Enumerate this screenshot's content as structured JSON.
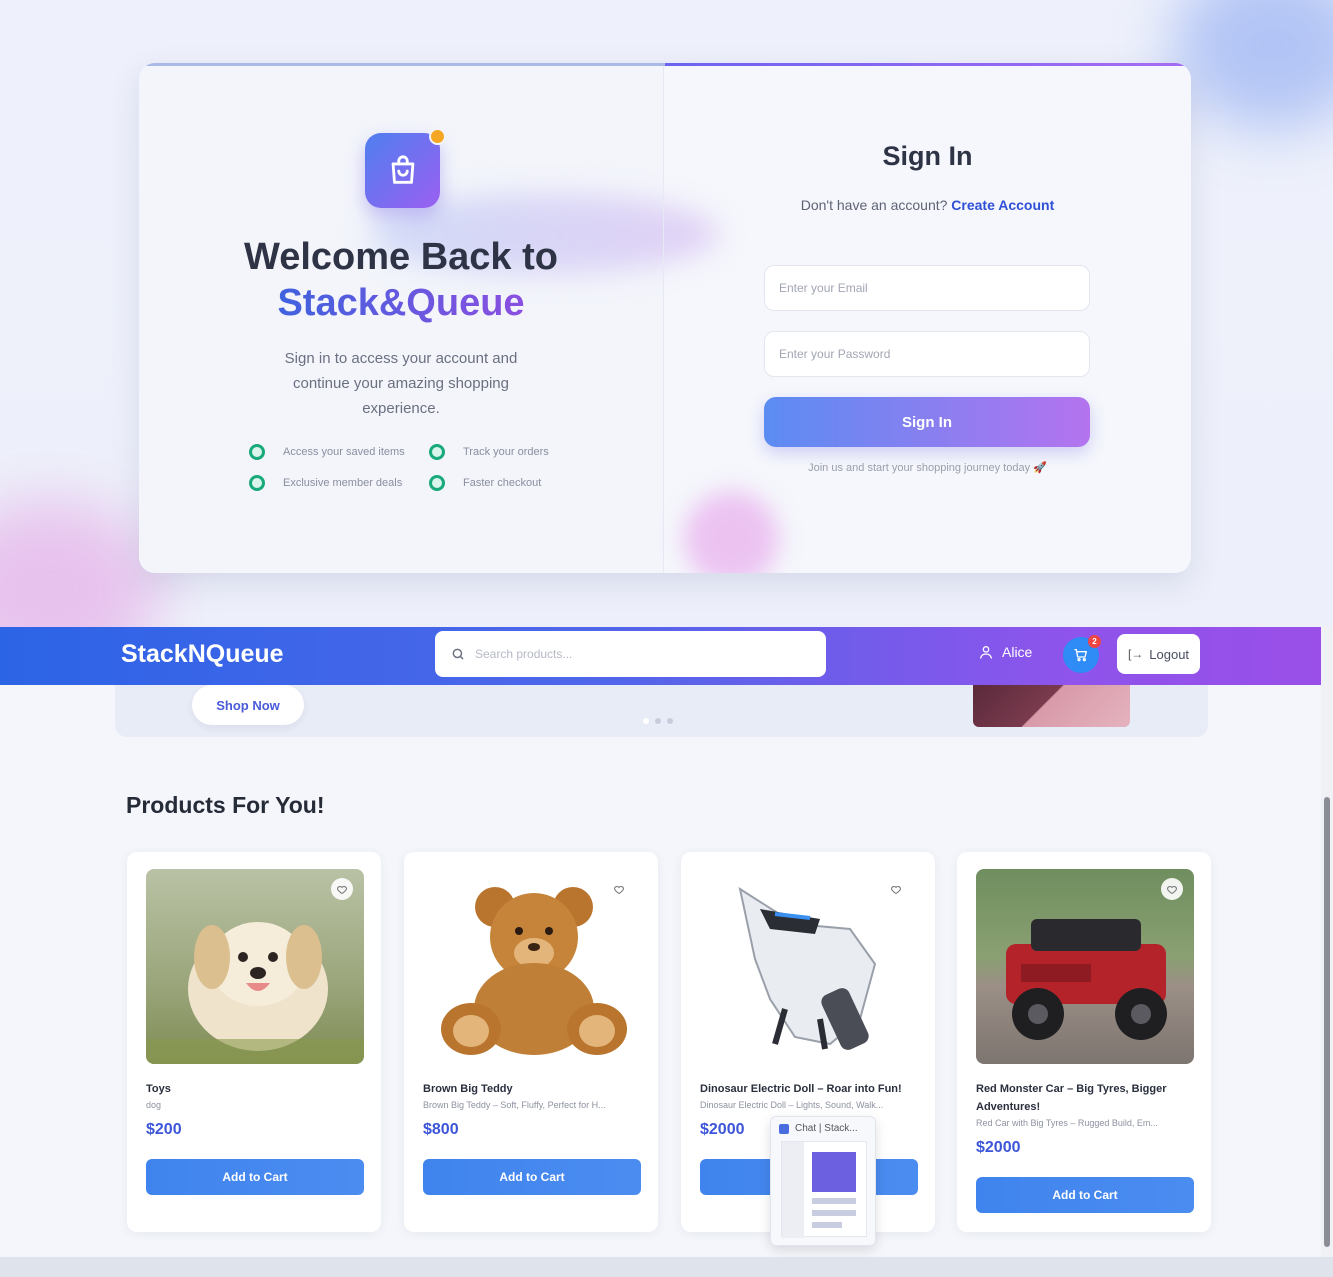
{
  "auth": {
    "welcome_line1": "Welcome Back to",
    "welcome_line2": "Stack&Queue",
    "subtitle": "Sign in to access your account and continue your amazing shopping experience.",
    "features": [
      "Access your saved items",
      "Track your orders",
      "Exclusive member deals",
      "Faster checkout"
    ],
    "title": "Sign In",
    "prompt_text": "Don't have an account?",
    "create_account_link": "Create Account",
    "email_placeholder": "Enter your Email",
    "password_placeholder": "Enter your Password",
    "signin_button": "Sign In",
    "footer_note": "Join us and start your shopping journey today",
    "footer_emoji": "🚀"
  },
  "store": {
    "brand": "StackNQueue",
    "search_placeholder": "Search products...",
    "user_name": "Alice",
    "cart_count": "2",
    "logout_label": "Logout",
    "shop_now_label": "Shop Now",
    "section_title": "Products For You!",
    "products": [
      {
        "name": "Toys",
        "desc": "dog",
        "price": "$200",
        "button": "Add to Cart"
      },
      {
        "name": "Brown Big Teddy",
        "desc": "Brown Big Teddy – Soft, Fluffy, Perfect for H...",
        "price": "$800",
        "button": "Add to Cart"
      },
      {
        "name": "Dinosaur Electric Doll – Roar into Fun!",
        "desc": "Dinosaur Electric Doll – Lights, Sound, Walk...",
        "price": "$2000",
        "button": "Add to Cart"
      },
      {
        "name": "Red Monster Car – Big Tyres, Bigger Adventures!",
        "desc": "Red Car with Big Tyres – Rugged Build, Em...",
        "price": "$2000",
        "button": "Add to Cart"
      }
    ],
    "popup_title": "Chat | Stack..."
  },
  "colors": {
    "accent_blue": "#2c64e6",
    "accent_purple": "#9a4fe9",
    "price": "#3d55d8",
    "check_green": "#19a97b"
  }
}
